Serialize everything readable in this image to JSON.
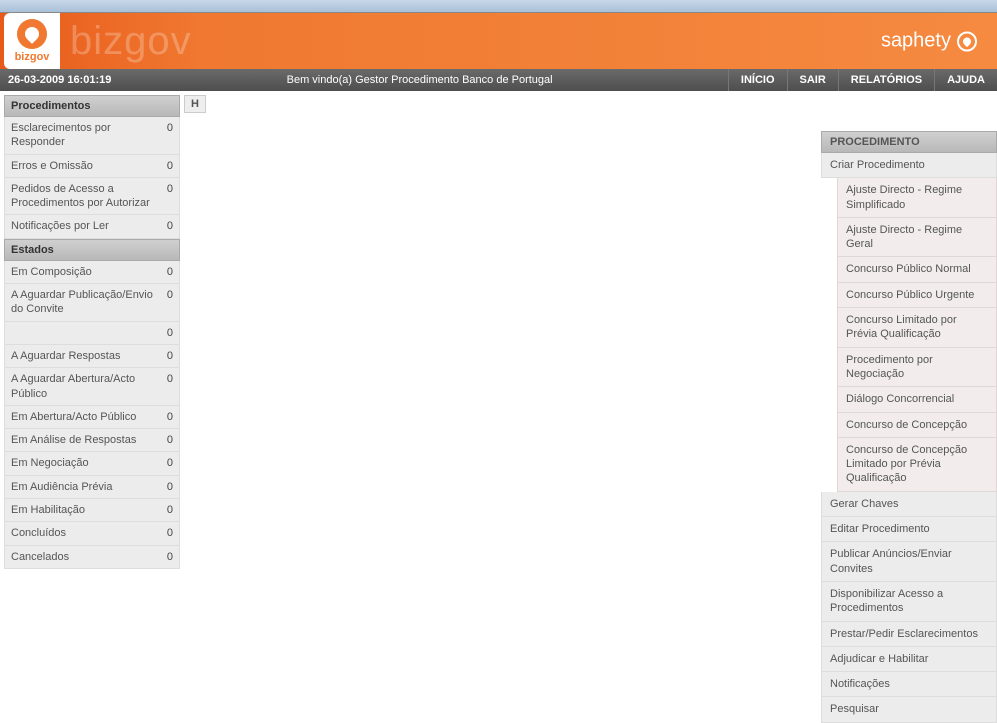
{
  "timestamp": "26-03-2009 16:01:19",
  "welcome": "Bem vindo(a) Gestor Procedimento Banco de Portugal",
  "nav": {
    "inicio": "INÍCIO",
    "sair": "SAIR",
    "relatorios": "RELATÓRIOS",
    "ajuda": "AJUDA"
  },
  "logo_text": "bizgov",
  "watermark": "bizgov",
  "brand": "saphety",
  "breadcrumb": "H",
  "left": {
    "procedimentos_header": "Procedimentos",
    "procedimentos": [
      {
        "label": "Esclarecimentos por Responder",
        "count": "0"
      },
      {
        "label": "Erros e Omissão",
        "count": "0"
      },
      {
        "label": "Pedidos de Acesso a Procedimentos por Autorizar",
        "count": "0"
      },
      {
        "label": "Notificações por Ler",
        "count": "0"
      }
    ],
    "estados_header": "Estados",
    "estados": [
      {
        "label": "Em Composição",
        "count": "0"
      },
      {
        "label": "A Aguardar Publicação/Envio do Convite",
        "count": "0",
        "extra_count": "0"
      },
      {
        "label": "A Aguardar Respostas",
        "count": "0"
      },
      {
        "label": "A Aguardar Abertura/Acto Público",
        "count": "0"
      },
      {
        "label": "Em Abertura/Acto Público",
        "count": "0"
      },
      {
        "label": "Em Análise de Respostas",
        "count": "0"
      },
      {
        "label": "Em Negociação",
        "count": "0"
      },
      {
        "label": "Em Audiência Prévia",
        "count": "0"
      },
      {
        "label": "Em Habilitação",
        "count": "0"
      },
      {
        "label": "Concluídos",
        "count": "0"
      },
      {
        "label": "Cancelados",
        "count": "0"
      }
    ]
  },
  "right": {
    "header": "PROCEDIMENTO",
    "criar": "Criar Procedimento",
    "criar_sub": [
      "Ajuste Directo - Regime Simplificado",
      "Ajuste Directo - Regime Geral",
      "Concurso Público Normal",
      "Concurso Público Urgente",
      "Concurso Limitado por Prévia Qualificação",
      "Procedimento por Negociação",
      "Diálogo Concorrencial",
      "Concurso de Concepção",
      "Concurso de Concepção Limitado por Prévia Qualificação"
    ],
    "actions": [
      "Gerar Chaves",
      "Editar Procedimento",
      "Publicar Anúncios/Enviar Convites",
      "Disponibilizar Acesso a Procedimentos",
      "Prestar/Pedir Esclarecimentos",
      "Adjudicar e Habilitar",
      "Notificações",
      "Pesquisar"
    ]
  }
}
